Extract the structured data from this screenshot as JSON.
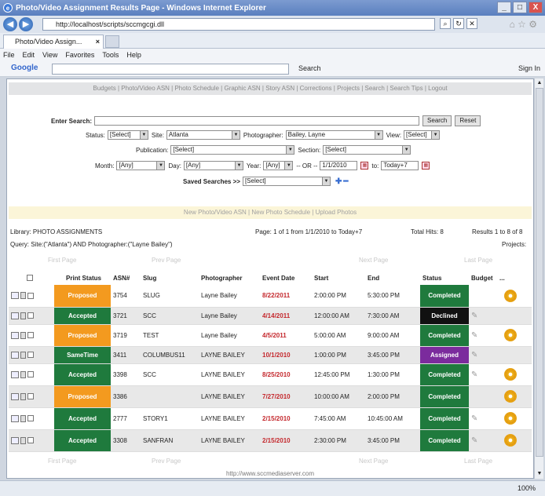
{
  "window": {
    "title": "Photo/Video Assignment Results Page - Windows Internet Explorer",
    "url": "http://localhost/scripts/sccmgcgi.dll",
    "tab_label": "Photo/Video Assign...",
    "minimize": "_",
    "maximize": "□",
    "close": "X"
  },
  "menu": [
    "File",
    "Edit",
    "View",
    "Favorites",
    "Tools",
    "Help"
  ],
  "google_bar": {
    "logo": "Google",
    "search_label": "Search",
    "sign_in": "Sign In"
  },
  "nav_links": "Budgets | Photo/Video ASN | Photo Schedule | Graphic ASN | Story ASN | Corrections | Projects | Search | Search Tips | Logout",
  "search": {
    "enter_search_label": "Enter Search:",
    "enter_search_value": "",
    "search_button": "Search",
    "reset_button": "Reset",
    "status_label": "Status:",
    "status_value": "[Select]",
    "site_label": "Site:",
    "site_value": "Atlanta",
    "photographer_label": "Photographer:",
    "photographer_value": "Bailey, Layne",
    "view_label": "View:",
    "view_value": "[Select]",
    "publication_label": "Publication:",
    "publication_value": "[Select]",
    "section_label": "Section:",
    "section_value": "[Select]",
    "month_label": "Month:",
    "month_value": "[Any]",
    "day_label": "Day:",
    "day_value": "[Any]",
    "year_label": "Year:",
    "year_value": "[Any]",
    "or_label": "-- OR --",
    "from_value": "1/1/2010",
    "to_label": "to:",
    "to_value": "Today+7",
    "saved_label": "Saved Searches >>",
    "saved_value": "[Select]"
  },
  "link_bar": "New Photo/Video ASN | New Photo Schedule | Upload Photos",
  "info": {
    "library": "Library: PHOTO ASSIGNMENTS",
    "page": "Page: 1 of 1  from 1/1/2010 to Today+7",
    "total_hits": "Total Hits: 8",
    "results": "Results 1 to 8 of 8",
    "query": "Query: Site:(\"Atlanta\") AND Photographer:(\"Layne Bailey\")",
    "projects": "Projects:"
  },
  "pager": {
    "first": "First Page",
    "prev": "Prev Page",
    "next": "Next Page",
    "last": "Last Page"
  },
  "table": {
    "headers": [
      "Print Status",
      "ASN#",
      "Slug",
      "Photographer",
      "Event Date",
      "Start",
      "End",
      "Status",
      "Budget",
      "..."
    ],
    "rows": [
      {
        "print_status": "Proposed",
        "asn": "3754",
        "slug": "SLUG",
        "photographer": "Layne Bailey",
        "event_date": "8/22/2011",
        "start": "2:00:00 PM",
        "end": "5:30:00 PM",
        "status": "Completed"
      },
      {
        "print_status": "Accepted",
        "asn": "3721",
        "slug": "SCC",
        "photographer": "Layne Bailey",
        "event_date": "4/14/2011",
        "start": "12:00:00 AM",
        "end": "7:30:00 AM",
        "status": "Declined"
      },
      {
        "print_status": "Proposed",
        "asn": "3719",
        "slug": "TEST",
        "photographer": "Layne Bailey",
        "event_date": "4/5/2011",
        "start": "5:00:00 AM",
        "end": "9:00:00 AM",
        "status": "Completed"
      },
      {
        "print_status": "SameTime",
        "asn": "3411",
        "slug": "COLUMBUS11",
        "photographer": "LAYNE BAILEY",
        "event_date": "10/1/2010",
        "start": "1:00:00 PM",
        "end": "3:45:00 PM",
        "status": "Assigned"
      },
      {
        "print_status": "Accepted",
        "asn": "3398",
        "slug": "SCC",
        "photographer": "LAYNE BAILEY",
        "event_date": "8/25/2010",
        "start": "12:45:00 PM",
        "end": "1:30:00 PM",
        "status": "Completed"
      },
      {
        "print_status": "Proposed",
        "asn": "3386",
        "slug": "",
        "photographer": "LAYNE BAILEY",
        "event_date": "7/27/2010",
        "start": "10:00:00 AM",
        "end": "2:00:00 PM",
        "status": "Completed"
      },
      {
        "print_status": "Accepted",
        "asn": "2777",
        "slug": "STORY1",
        "photographer": "LAYNE BAILEY",
        "event_date": "2/15/2010",
        "start": "7:45:00 AM",
        "end": "10:45:00 AM",
        "status": "Completed"
      },
      {
        "print_status": "Accepted",
        "asn": "3308",
        "slug": "SANFRAN",
        "photographer": "LAYNE BAILEY",
        "event_date": "2/15/2010",
        "start": "2:30:00 PM",
        "end": "3:45:00 PM",
        "status": "Completed"
      }
    ]
  },
  "footer_url": "http://www.sccmediaserver.com",
  "zoom": "100%",
  "colors": {
    "accepted": "#1f7a3d",
    "proposed": "#f39a1f",
    "declined": "#111111",
    "assigned": "#7b2b9d",
    "date_red": "#c4282d"
  }
}
